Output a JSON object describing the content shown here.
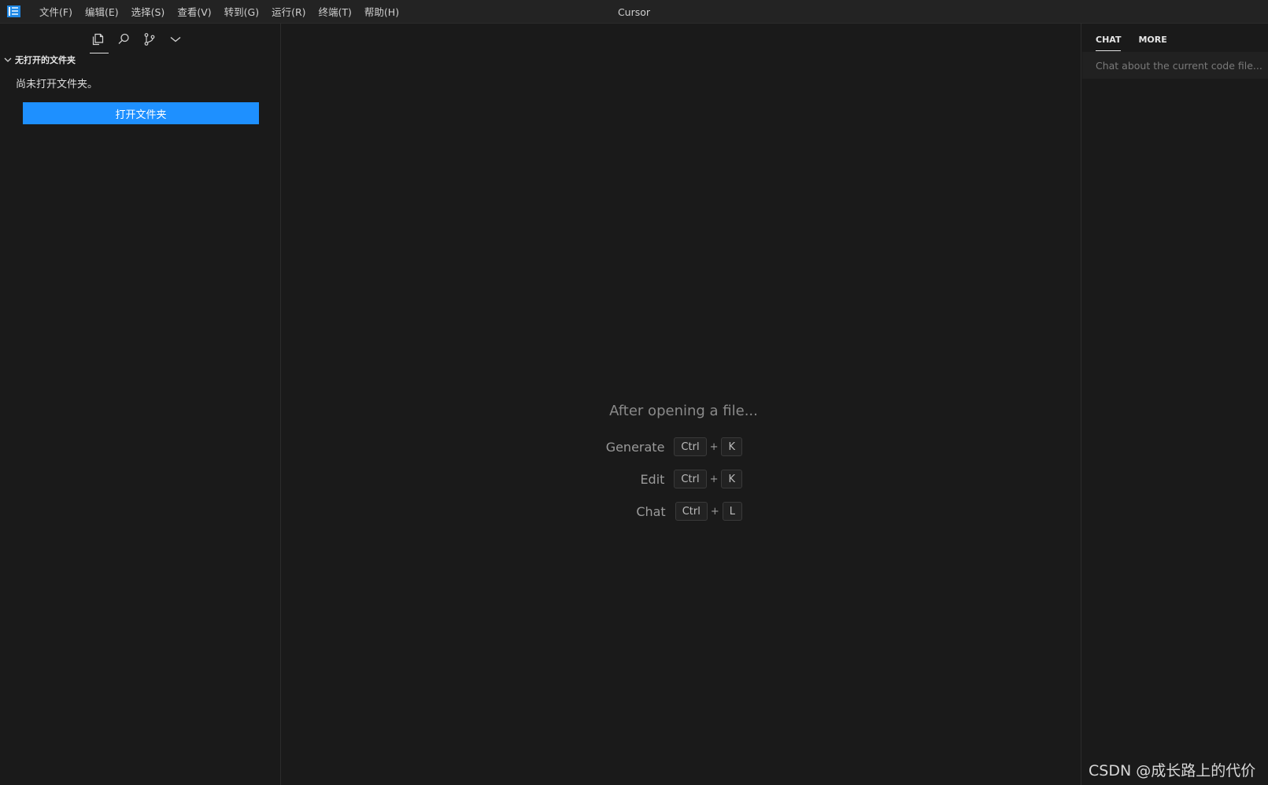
{
  "window": {
    "title": "Cursor"
  },
  "menu": {
    "items": [
      {
        "label": "文件(F)"
      },
      {
        "label": "编辑(E)"
      },
      {
        "label": "选择(S)"
      },
      {
        "label": "查看(V)"
      },
      {
        "label": "转到(G)"
      },
      {
        "label": "运行(R)"
      },
      {
        "label": "终端(T)"
      },
      {
        "label": "帮助(H)"
      }
    ]
  },
  "sidebar": {
    "tabs": [
      {
        "icon": "files-icon",
        "active": true
      },
      {
        "icon": "search-icon",
        "active": false
      },
      {
        "icon": "source-control-icon",
        "active": false
      },
      {
        "icon": "chevron-down-icon",
        "active": false
      }
    ],
    "section_title": "无打开的文件夹",
    "empty_message": "尚未打开文件夹。",
    "open_folder_label": "打开文件夹"
  },
  "editor": {
    "hint_title": "After opening a file...",
    "shortcuts": [
      {
        "label": "Generate",
        "keys": [
          "Ctrl",
          "K"
        ]
      },
      {
        "label": "Edit",
        "keys": [
          "Ctrl",
          "K"
        ]
      },
      {
        "label": "Chat",
        "keys": [
          "Ctrl",
          "L"
        ]
      }
    ],
    "plus": "+"
  },
  "chat_panel": {
    "tabs": [
      {
        "label": "CHAT",
        "active": true
      },
      {
        "label": "MORE",
        "active": false
      }
    ],
    "input_placeholder": "Chat about the current code file..."
  },
  "watermark": "CSDN @成长路上的代价",
  "colors": {
    "accent": "#1e90ff",
    "background": "#1a1a1a",
    "titlebar": "#232323"
  }
}
